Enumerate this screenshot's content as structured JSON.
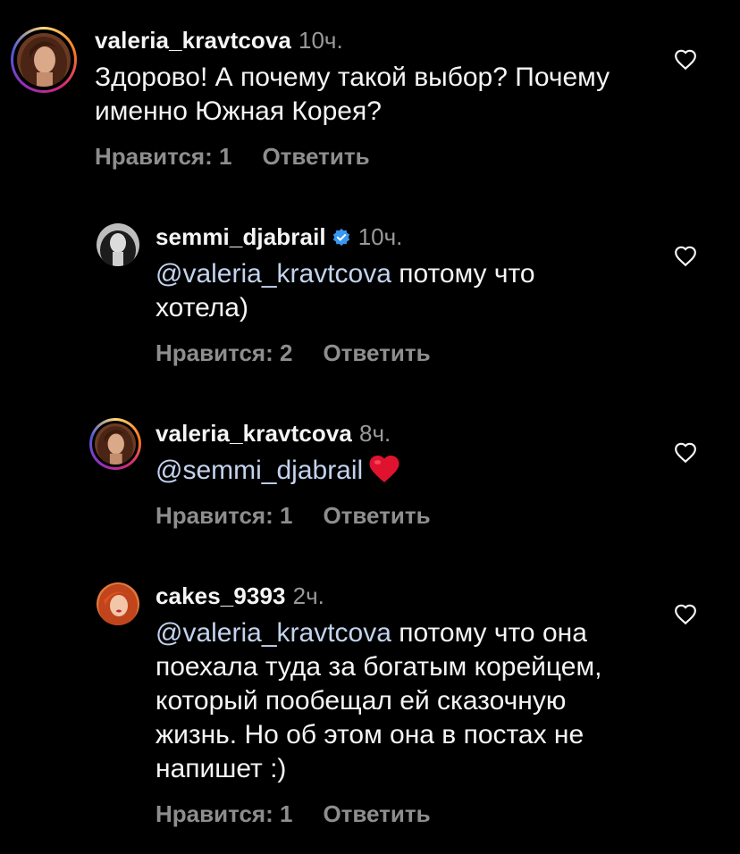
{
  "colors": {
    "background": "#000000",
    "text": "#f5f5f5",
    "muted": "#8e8e8e",
    "mention": "#c3d3ee",
    "verified": "#3897f0",
    "heart_emoji": "#e0132f"
  },
  "comments": [
    {
      "username": "valeria_kravtcova",
      "time": "10ч.",
      "mention": "",
      "text": "Здорово! А почему такой выбор? Почему именно Южная Корея?",
      "likes": "Нравится: 1",
      "reply": "Ответить",
      "has_story_ring": true,
      "verified": false
    },
    {
      "username": "semmi_djabrail",
      "time": "10ч.",
      "mention": "@valeria_kravtcova",
      "text": " потому что хотела)",
      "likes": "Нравится: 2",
      "reply": "Ответить",
      "has_story_ring": false,
      "verified": true
    },
    {
      "username": "valeria_kravtcova",
      "time": "8ч.",
      "mention": "@semmi_djabrail",
      "text": "",
      "emoji": "red-heart",
      "likes": "Нравится: 1",
      "reply": "Ответить",
      "has_story_ring": true,
      "verified": false
    },
    {
      "username": "cakes_9393",
      "time": "2ч.",
      "mention": "@valeria_kravtcova",
      "text": " потому что она поехала туда за богатым корейцем, который пообещал ей сказочную жизнь. Но об этом она в постах не напишет :)",
      "likes": "Нравится: 1",
      "reply": "Ответить",
      "has_story_ring": false,
      "verified": false
    }
  ],
  "icons": {
    "like": "heart-outline-icon",
    "verified": "verified-badge-icon"
  }
}
